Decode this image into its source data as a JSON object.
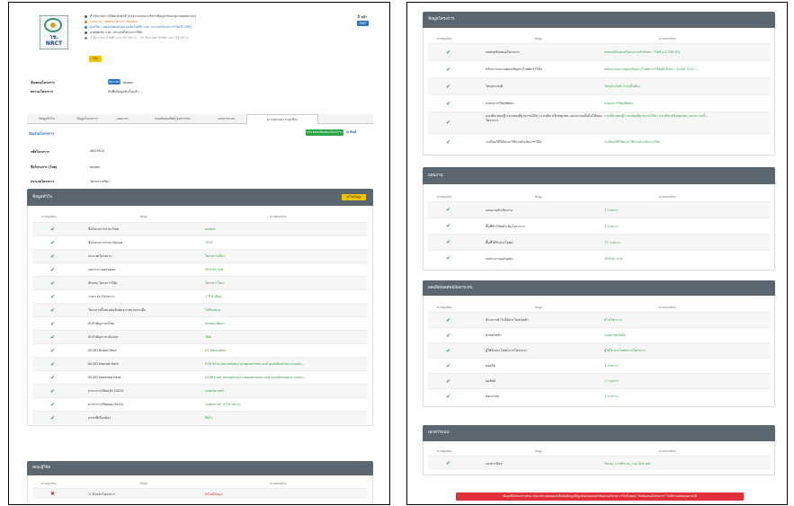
{
  "left": {
    "header": {
      "logo_text": "วช.\nNRCT",
      "lines": [
        "สำนักงานการวิจัยแห่งชาติ (กองระบบและบริหารข้อมูลฯ/หน่วยงานคุณธรรม)",
        "แผนงาน : ทดสอบโครงการทดสอบ",
        "ทุนวิจัย : ทดสอบทดสอบแบบอัตโนมัติ รวม. ประเภทโครงการวิจัย ปี 2567",
        "แบบฟอร์ม รวม. ประเภทโครงการวิจัย",
        "1 ธันวาคม 2566 เวลา 00:00 น. - 31 ธันวาคม 2566 เวลา 23:59 น."
      ],
      "status_badge": "เปิด",
      "top_right_label": "ปี หน้า",
      "top_right_badge": "2567"
    },
    "meta": [
      {
        "label": "ข้อเสนอโครงการ",
        "badge": "4807403",
        "value": "ทดสอบ"
      },
      {
        "label": "สถานะโครงการ",
        "value": "บันทึกข้อมูลสำเร็จแล้ว"
      }
    ],
    "tabs": [
      "ข้อมูลทั่วไป",
      "ข้อมูลโครงการ",
      "แผนงาน",
      "ผลผลิต/ผลลัพธ์/ผลกระทบ",
      "เอกสารแนบ",
      "ตรวจสอบความถูกต้อง"
    ],
    "section_title": "ข้อเสนอโครงการ",
    "check_button": "ตรวจสอบข้อเสนอโครงการ",
    "print_label": "พิมพ์",
    "info": [
      {
        "label": "รหัสโครงการ",
        "value": "4807403"
      },
      {
        "label": "ชื่อโครงการ (ไทย)",
        "value": "ทดสอบ"
      },
      {
        "label": "ประเภทโครงการ",
        "value": "โครงการเดี่ยว"
      }
    ],
    "general_panel": {
      "title": "ข้อมูลทั่วไป",
      "edit_button": "แก้ไขข้อมูล",
      "cols": [
        "ความถูกต้อง",
        "ข้อมูล",
        "ความครบถ้วน"
      ],
      "rows": [
        {
          "status": "ok",
          "field": "ชื่อโครงการภาษาไทย",
          "value": "ทดสอบ"
        },
        {
          "status": "ok",
          "field": "ชื่อโครงการภาษาอังกฤษ",
          "value": "TEST"
        },
        {
          "status": "ok",
          "field": "ประเภทโครงการ",
          "value": "โครงการเดี่ยว"
        },
        {
          "status": "ok",
          "field": "งบประมาณเสนอขอ",
          "value": "399.00 บาท"
        },
        {
          "status": "ok",
          "field": "ลักษณะโครงการวิจัย",
          "value": "โครงการใหม่"
        },
        {
          "status": "ok",
          "field": "ระยะเวลาโครงการ",
          "value": "1 ปี 0 เดือน"
        },
        {
          "status": "ok",
          "field": "โครงการนี้เสนอขอรับทุนจากหน่วยงานอื่น",
          "value": "ไม่ยื่นเสนอ"
        },
        {
          "status": "ok",
          "field": "คำสำคัญภาษาไทย",
          "value": "ทดสอบ,พัฒนา"
        },
        {
          "status": "ok",
          "field": "คำสำคัญภาษาอังกฤษ",
          "value": "Test"
        },
        {
          "status": "ok",
          "field": "ISCED Broad field",
          "value": "01 Education"
        },
        {
          "status": "ok",
          "field": "ISCED Narrow field",
          "value": "018 Inter-disciplinary programmes and qualifications involv..."
        },
        {
          "status": "ok",
          "field": "ISCED Detailed field",
          "value": "0188 Inter-disciplinary programmes and qualifications involv..."
        },
        {
          "status": "ok",
          "field": "สาขาการวิจัยหลัก OECD",
          "value": "เกษตรศาสตร์"
        },
        {
          "status": "ok",
          "field": "สาขาการวิจัยย่อย OECD",
          "value": "เกษตรกรรม ป่าไม้ ประมง"
        },
        {
          "status": "ok",
          "field": "สาขาที่เกี่ยวข้อง",
          "value": "พืชไร่"
        }
      ]
    },
    "researcher_panel": {
      "title": "คณะผู้วิจัย",
      "cols": [
        "ความถูกต้อง",
        "ข้อมูล",
        "ความครบถ้วน"
      ],
      "rows": [
        {
          "status": "error",
          "field": "1. หัวหน้าโครงการ",
          "value": "ยังไม่มีข้อมูล"
        }
      ]
    }
  },
  "right": {
    "project_panel": {
      "title": "ข้อมูลโครงการ",
      "cols": [
        "ความถูกต้อง",
        "ข้อมูล",
        "ความครบถ้วน"
      ],
      "rows": [
        {
          "status": "ok",
          "field": "บทสรุปข้อเสนอโครงการ",
          "value": "บทสรุปข้อเสนอโครงการ(ตัวอักษร : ไม่เกิน 3,000 คำ)"
        },
        {
          "status": "ok",
          "field": "หลักการและเหตุผล/ปัญหา/โจทย์การวิจัย",
          "value": "หลักการและเหตุผล/ปัญหา/โจทย์การวิจัย(ตัวอักษร : ไม่เกิน 3,00..."
        },
        {
          "status": "ok",
          "field": "วัตถุประสงค์",
          "value": "วัตถุประสงค์ (ระบุเป็นข้อ)"
        },
        {
          "status": "ok",
          "field": "กรอบการวิจัย/พัฒนา",
          "value": "กรอบการวิจัย/พัฒนา"
        },
        {
          "status": "ok",
          "field": "แนวคิด ทฤษฎี และสมมุติฐานงานวิจัย / แนวคิด บริบทชุมชน และความเป็นไปได้ของโครงการ",
          "value": "แนวคิด ทฤษฎี และสมมุติฐานงานวิจัย / แนวคิด บริบทชุมชน และความเป็..."
        },
        {
          "status": "ok",
          "field": "ระเบียบวิธีวิจัยและวิธีการดำเนินการวิจัย",
          "value": "ระเบียบวิธีวิจัยและวิธีการดำเนินการวิจัย"
        }
      ]
    },
    "plan_panel": {
      "title": "แผนงาน",
      "cols": [
        "ความถูกต้อง",
        "ข้อมูล",
        "ความครบถ้วน"
      ],
      "rows": [
        {
          "status": "ok",
          "field": "แผนงานดำเนินงาน",
          "value": "1 รายการ"
        },
        {
          "status": "ok",
          "field": "พื้นที่ทำวิจัย/ดำเนินโครงการ",
          "value": "1 รายการ"
        },
        {
          "status": "ok",
          "field": "พื้นที่ได้รับประโยชน์",
          "value": "77 รายการ"
        },
        {
          "status": "ok",
          "field": "งบประมาณเสนอขอ",
          "value": "399.00 บาท"
        }
      ]
    },
    "output_panel": {
      "title": "ผลผลิต/ผลลัพธ์/ผลกระทบ",
      "cols": [
        "ความถูกต้อง",
        "ข้อมูล",
        "ความครบถ้วน"
      ],
      "rows": [
        {
          "status": "ok",
          "field": "ด้านการนำไปใช้ประโยชน์หลัก",
          "value": "ด้านวิชาการ"
        },
        {
          "status": "ok",
          "field": "ศาสตร์หลัก",
          "value": "ระบุศาสตร์หลัก"
        },
        {
          "status": "ok",
          "field": "ผู้ใช้รับประโยชน์จากโครงการ",
          "value": "ผู้ได้รับประโยชน์จากโครงการ"
        },
        {
          "status": "ok",
          "field": "ผลผลิต",
          "value": "1 รายการ"
        },
        {
          "status": "ok",
          "field": "ผลลัพธ์",
          "value": "1 รายการ"
        },
        {
          "status": "ok",
          "field": "ผลกระทบ",
          "value": "1 รายการ"
        }
      ]
    },
    "attach_panel": {
      "title": "เอกสารแนบ",
      "cols": [
        "ความถูกต้อง",
        "ข้อมูล",
        "ความครบถ้วน"
      ],
      "rows": [
        {
          "status": "ok",
          "field": "เอกสารอื่นๆ",
          "value": "รับรอง_การทำงาน_ก.ค.-มิ.ค.pdf"
        }
      ]
    },
    "submit_notice": "ข้อมูลถึงโครงการครบ กรุณาตรวจสอบและยืนยันข้อมูลให้ถูกต้องก่อนกดส่งข้อเสนอโครงการในขั้นตอน \"ส่งข้อเสนอโครงการ\" ไม่มีระบบส่งคุณอ่านได้"
  },
  "colors": {
    "ok": "#2e9e3f",
    "error": "#d93434",
    "panel_header": "#5b6770",
    "badge_blue": "#2a73c9",
    "badge_yellow": "#f2c200",
    "check_green": "#28a745",
    "notice_red": "#e0313a"
  }
}
